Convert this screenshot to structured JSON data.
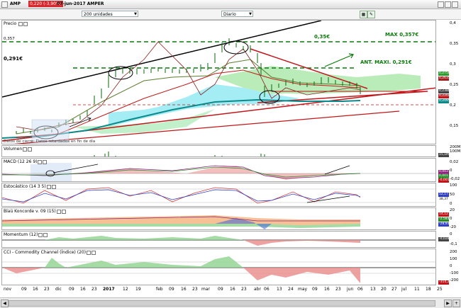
{
  "window": {
    "ticker": "AMP",
    "price_badge": "0,220 (-3,90%)",
    "date_title": "07-jun-2017 AMPER"
  },
  "toolbar": {
    "units_value": "200 unidades",
    "period_value": "Diario"
  },
  "panels": {
    "price": {
      "label": "Precio",
      "annotations": {
        "left_level": "0,291€",
        "top_left_level": "0,357",
        "mid_level": "0,35€",
        "max_label": "MAX 0,357€",
        "ant_max_label": "ANT. MAXI. 0,291€"
      },
      "footer_note": "Datos de cierre: Datos retardados en fin de día",
      "axis": [
        "0,4",
        "0,35",
        "0,3",
        "0,25",
        "0,2",
        "0,15"
      ],
      "tags": [
        "0,2758",
        "0,2635",
        "0,2388",
        "0,2204",
        "0,2095"
      ]
    },
    "volume": {
      "label": "Volumen",
      "axis": [
        "200M",
        "100M"
      ],
      "tag": "15,1M"
    },
    "macd": {
      "label": "MACD (12 26 9)",
      "axis": [
        "0,02",
        "0",
        "-0,02"
      ],
      "tags": [
        "0,003",
        "0,001",
        "-0,001"
      ]
    },
    "stoch": {
      "label": "Estocástico (14 3 5)",
      "axis": [
        "100",
        "50",
        "0"
      ],
      "tags": [
        "52,17",
        "38,37"
      ]
    },
    "blau": {
      "label": "Blaü Koncorde v. 09 (15)",
      "axis": [
        "20",
        "0",
        "-20"
      ],
      "tags": [
        "14,12",
        "-2,583",
        "-28,93"
      ]
    },
    "momentum": {
      "label": "Momentum (12)",
      "axis": [
        "0",
        "-0,1"
      ],
      "tag": "-0,028"
    },
    "cci": {
      "label": "CCI - Commodity Channel (Índice) (20)",
      "axis": [
        "200",
        "100",
        "0",
        "-100",
        "-200"
      ],
      "tag": "-314,2"
    }
  },
  "xaxis": {
    "labels": [
      "nov",
      "09",
      "16",
      "23",
      "dic",
      "09",
      "16",
      "23",
      "2017",
      "12",
      "19",
      "feb",
      "09",
      "16",
      "23",
      "mar",
      "09",
      "16",
      "23",
      "abr",
      "06",
      "13",
      "24",
      "may",
      "09",
      "16",
      "23",
      "jun",
      "06",
      "13",
      "20",
      "27",
      "jul",
      "11",
      "18",
      "25"
    ]
  },
  "colors": {
    "price_down_badge": "#d8262b",
    "support_red": "#c0161a",
    "annotation_green": "#0a7a0a",
    "cloud_green": "#8ce08c",
    "cloud_cyan": "#7fe6f0"
  }
}
